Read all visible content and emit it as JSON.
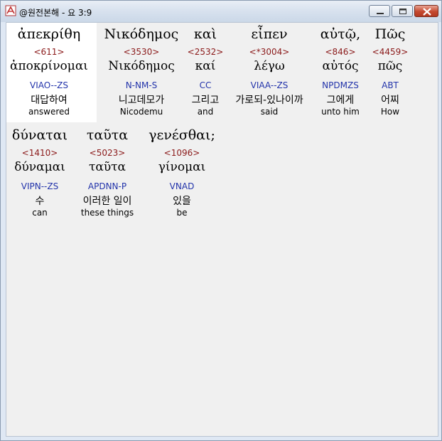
{
  "window": {
    "title": "@원전본해 - 요 3:9"
  },
  "words": [
    {
      "greek": "ἀπεκρίθη",
      "strong": "<611>",
      "lemma": "ἀποκρίνομαι",
      "parse": "VIAO--ZS",
      "korean": "대답하여",
      "english": "answered"
    },
    {
      "greek": "Νικόδημος",
      "strong": "<3530>",
      "lemma": "Νικόδημος",
      "parse": "N-NM-S",
      "korean": "니고데모가",
      "english": "Nicodemu"
    },
    {
      "greek": "καὶ",
      "strong": "<2532>",
      "lemma": "καί",
      "parse": "CC",
      "korean": "그리고",
      "english": "and"
    },
    {
      "greek": "εἶπεν",
      "strong": "<*3004>",
      "lemma": "λέγω",
      "parse": "VIAA--ZS",
      "korean": "가로되-있나이까",
      "english": "said"
    },
    {
      "greek": "αὐτῷ,",
      "strong": "<846>",
      "lemma": "αὐτός",
      "parse": "NPDMZS",
      "korean": "그에게",
      "english": "unto him"
    },
    {
      "greek": "Πῶς",
      "strong": "<4459>",
      "lemma": "πῶς",
      "parse": "ABT",
      "korean": "어찌",
      "english": "How"
    },
    {
      "greek": "δύναται",
      "strong": "<1410>",
      "lemma": "δύναμαι",
      "parse": "VIPN--ZS",
      "korean": "수",
      "english": "can"
    },
    {
      "greek": "ταῦτα",
      "strong": "<5023>",
      "lemma": "ταῦτα",
      "parse": "APDNN-P",
      "korean": "이러한 일이",
      "english": "these things"
    },
    {
      "greek": "γενέσθαι;",
      "strong": "<1096>",
      "lemma": "γίνομαι",
      "parse": "VNAD",
      "korean": "있을",
      "english": "be"
    }
  ],
  "colors": {
    "strong": "#8b1a1a",
    "parse": "#2233aa",
    "highlight": "#ffffff"
  },
  "icons": [
    "app-icon",
    "minimize-icon",
    "maximize-icon",
    "close-icon"
  ]
}
